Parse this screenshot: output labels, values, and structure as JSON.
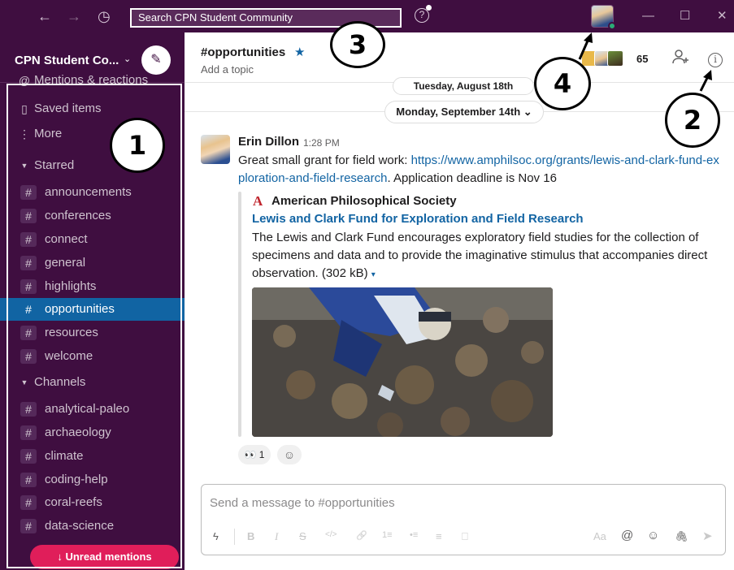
{
  "topbar": {
    "back_icon": "←",
    "forward_icon": "→",
    "history_icon": "◷",
    "search_placeholder": "Search CPN Student Community",
    "help_icon": "?",
    "minimize_icon": "—",
    "maximize_icon": "☐",
    "close_icon": "✕"
  },
  "sidebar": {
    "workspace_name": "CPN Student Co...",
    "workspace_chevron": "⌄",
    "compose_icon": "✎",
    "items": [
      {
        "label": "Mentions & reactions",
        "icon": "@"
      },
      {
        "label": "Saved items",
        "icon": "▯"
      },
      {
        "label": "More",
        "icon": "⋮"
      }
    ],
    "starred_label": "Starred",
    "starred": [
      "announcements",
      "conferences",
      "connect",
      "general",
      "highlights",
      "opportunities",
      "resources",
      "welcome"
    ],
    "channels_label": "Channels",
    "channels": [
      "analytical-paleo",
      "archaeology",
      "climate",
      "coding-help",
      "coral-reefs",
      "data-science"
    ],
    "unread_label": "↓ Unread mentions"
  },
  "channel": {
    "name": "#opportunities",
    "star_icon": "★",
    "topic": "Add a topic",
    "member_count": "65",
    "add_people_icon": "+",
    "info_icon": "i"
  },
  "dates": {
    "previous": "Tuesday, August 18th",
    "current": "Monday, September 14th ⌄"
  },
  "message": {
    "author": "Erin Dillon",
    "time": "1:28 PM",
    "text_before": "Great small grant for field work: ",
    "link": "https://www.amphilsoc.org/grants/lewis-and-clark-fund-exploration-and-field-research",
    "text_after": ". Application deadline is Nov 16",
    "unfurl": {
      "logo": "A",
      "site": "American Philosophical Society",
      "title": "Lewis and Clark Fund for Exploration and Field Research",
      "description": "The Lewis and Clark Fund encourages exploratory field studies for the collection of specimens and data and to provide the imaginative stimulus that accompanies direct observation.",
      "size": "(302 kB)",
      "caret": "▾"
    },
    "reaction_emoji": "👀",
    "reaction_count": "1",
    "add_reaction_icon": "☺"
  },
  "composer": {
    "placeholder": "Send a message to #opportunities",
    "shortcuts_icon": "ϟ",
    "tools": [
      "B",
      "I",
      "S",
      "</>",
      "🔗",
      "1≡",
      "•≡",
      "≡",
      "⎕"
    ],
    "right_tools": [
      "Aa",
      "@",
      "☺",
      "🖇",
      "➤"
    ]
  },
  "callouts": [
    "1",
    "2",
    "3",
    "4"
  ]
}
